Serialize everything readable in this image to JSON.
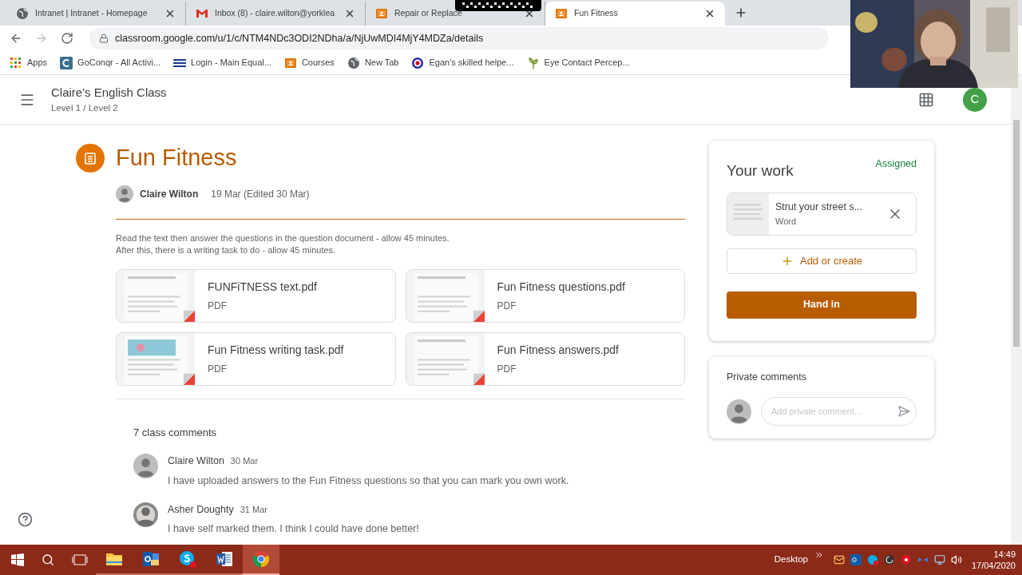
{
  "browser": {
    "tabs": [
      {
        "title": "Intranet | Intranet - Homepage",
        "kind": "globe",
        "selected": false
      },
      {
        "title": "Inbox (8) - claire.wilton@yorklea",
        "kind": "mail",
        "selected": false
      },
      {
        "title": "Repair or Replace",
        "kind": "classroom",
        "selected": false
      },
      {
        "title": "Fun Fitness",
        "kind": "classroom",
        "selected": true
      }
    ],
    "address": "classroom.google.com/u/1/c/NTM4NDc3ODI2NDha/a/NjUwMDI4MjY4MDZa/details",
    "bookmarks": [
      {
        "label": "Apps",
        "kind": "grid"
      },
      {
        "label": "GoConqr - All Activi...",
        "kind": "goconqr"
      },
      {
        "label": "Login - Main Equal...",
        "kind": "lines"
      },
      {
        "label": "Courses",
        "kind": "classroom"
      },
      {
        "label": "New Tab",
        "kind": "globe"
      },
      {
        "label": "Egan's skilled helpe...",
        "kind": "target"
      },
      {
        "label": "Eye Contact Percep...",
        "kind": "plant"
      }
    ]
  },
  "header": {
    "class_name": "Claire's English Class",
    "breadcrumb": "Level 1 / Level 2",
    "avatar_letter": "C"
  },
  "assignment": {
    "title": "Fun Fitness",
    "author": "Claire Wilton",
    "date": "19 Mar (Edited 30 Mar)",
    "instructions": [
      "Read the text then answer the questions in the question document - allow 45 minutes.",
      "After this, there is a writing task to do - allow 45 minutes."
    ],
    "attachments": [
      {
        "name": "FUNFiTNESS text.pdf",
        "type": "PDF",
        "kind": "text"
      },
      {
        "name": "Fun Fitness questions.pdf",
        "type": "PDF",
        "kind": "text"
      },
      {
        "name": "Fun Fitness writing task.pdf",
        "type": "PDF"
      },
      {
        "name": "Fun Fitness answers.pdf",
        "type": "PDF",
        "kind": "text"
      }
    ]
  },
  "comments": {
    "count_label": "7 class comments",
    "items": [
      {
        "author": "Claire Wilton",
        "date": "30 Mar",
        "text": "I have uploaded answers to the Fun Fitness questions so that you can mark you own work.",
        "kind": "default"
      },
      {
        "author": "Asher Doughty",
        "date": "31 Mar",
        "text": "I have self marked them. I think I could have done better!"
      }
    ]
  },
  "your_work": {
    "title": "Your work",
    "status": "Assigned",
    "file": {
      "name": "Strut your street s...",
      "type": "Word"
    },
    "add_label": "Add or create",
    "hand_in_label": "Hand in"
  },
  "private_comments": {
    "title": "Private comments",
    "placeholder": "Add private comment..."
  },
  "taskbar": {
    "apps": [
      {
        "kind": "folder",
        "active": false
      },
      {
        "kind": "outlook",
        "active": false
      },
      {
        "kind": "skype",
        "active": false
      },
      {
        "kind": "word",
        "active": false
      },
      {
        "kind": "chrome",
        "active": true
      }
    ],
    "desktop_label": "Desktop",
    "time": "14:49",
    "date": "17/04/2020"
  }
}
